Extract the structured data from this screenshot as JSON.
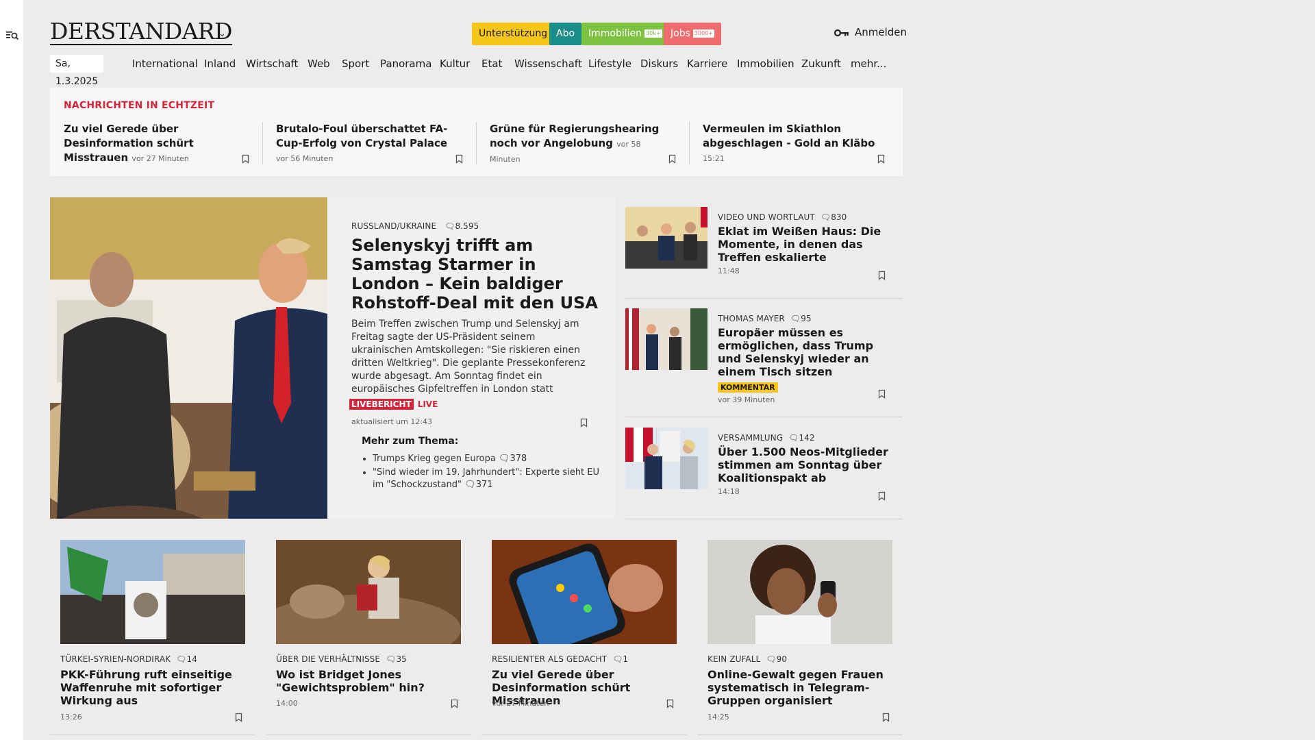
{
  "brand": {
    "logo_text": "DERSTANDARD"
  },
  "header": {
    "pills": [
      {
        "label": "Unterstützung",
        "bg": "#f5c518",
        "fg": "#1a1a1a"
      },
      {
        "label": "Abo",
        "bg": "#1a8c8a",
        "fg": "#ffffff"
      },
      {
        "label": "Immobilien",
        "tag": "30k+",
        "bg": "#7ec242",
        "fg": "#ffffff"
      },
      {
        "label": "Jobs",
        "tag": "3000+",
        "bg": "#f06c6c",
        "fg": "#ffffff"
      }
    ],
    "login_label": "Anmelden"
  },
  "nav": {
    "date": "Sa, 1.3.2025",
    "items": [
      "International",
      "Inland",
      "Wirtschaft",
      "Web",
      "Sport",
      "Panorama",
      "Kultur",
      "Etat",
      "Wissenschaft",
      "Lifestyle",
      "Diskurs",
      "Karriere",
      "Immobilien",
      "Zukunft",
      "mehr..."
    ]
  },
  "ticker": {
    "title": "NACHRICHTEN IN ECHTZEIT",
    "items": [
      {
        "headline": "Zu viel Gerede über Desinformation schürt Misstrauen",
        "time": "vor 27 Minuten"
      },
      {
        "headline": "Brutalo-Foul überschattet FA-Cup-Erfolg von Crystal Palace",
        "time": "vor 56 Minuten"
      },
      {
        "headline": "Grüne für Regierungshearing noch vor Angelobung",
        "time": "vor 58 Minuten"
      },
      {
        "headline": "Vermeulen im Skiathlon abgeschlagen - Gold an Kläbo",
        "time": "15:21"
      }
    ]
  },
  "hero": {
    "kicker": "RUSSLAND/UKRAINE",
    "comments": "8.595",
    "headline": "Selenyskyj trifft am Samstag Starmer in London – Kein baldiger Rohstoff-Deal mit den USA",
    "teaser": "Beim Treffen zwischen Trump und Selenskyj am Freitag sagte der US-Präsident seinem ukrainischen Amtskollegen: \"Sie riskieren einen dritten Weltkrieg\". Die geplante Pressekonferenz wurde abgesagt. Am Sonntag findet ein europäisches Gipfeltreffen in London statt",
    "live_badge": "LIVEBERICHT",
    "live_label": "LIVE",
    "updated": "aktualisiert um 12:43",
    "more_title": "Mehr zum Thema:",
    "more": [
      {
        "text": "Trumps Krieg gegen Europa",
        "comments": "378"
      },
      {
        "text": "\"Sind wieder im 19. Jahrhundert\": Experte sieht EU im \"Schockzustand\"",
        "comments": "371"
      }
    ]
  },
  "side": [
    {
      "kicker": "VIDEO UND WORTLAUT",
      "comments": "830",
      "headline": "Eklat im Weißen Haus: Die Momente, in denen das Treffen eskalierte",
      "time": "11:48"
    },
    {
      "kicker": "THOMAS MAYER",
      "comments": "95",
      "headline": "Europäer müssen es ermöglichen, dass Trump und Selenskyj wieder an einem Tisch sitzen",
      "badge": "KOMMENTAR",
      "time": "vor 39 Minuten"
    },
    {
      "kicker": "VERSAMMLUNG",
      "comments": "142",
      "headline": "Über 1.500 Neos-Mitglieder stimmen am Sonntag über Koalitionspakt ab",
      "time": "14:18"
    }
  ],
  "cards": [
    {
      "kicker": "TÜRKEI-SYRIEN-NORDIRAK",
      "comments": "14",
      "headline": "PKK-Führung ruft einseitige Waffenruhe mit sofortiger Wirkung aus",
      "time": "13:26"
    },
    {
      "kicker": "ÜBER DIE VERHÄLTNISSE",
      "comments": "35",
      "headline": "Wo ist Bridget Jones \"Gewichtsproblem\" hin?",
      "time": "14:00"
    },
    {
      "kicker": "RESILIENTER ALS GEDACHT",
      "comments": "1",
      "headline": "Zu viel Gerede über Desinformation schürt Misstrauen",
      "time": "vor 27 Minuten"
    },
    {
      "kicker": "KEIN ZUFALL",
      "comments": "90",
      "headline": "Online-Gewalt gegen Frauen systematisch in Telegram-Gruppen organisiert",
      "time": "14:25"
    }
  ]
}
